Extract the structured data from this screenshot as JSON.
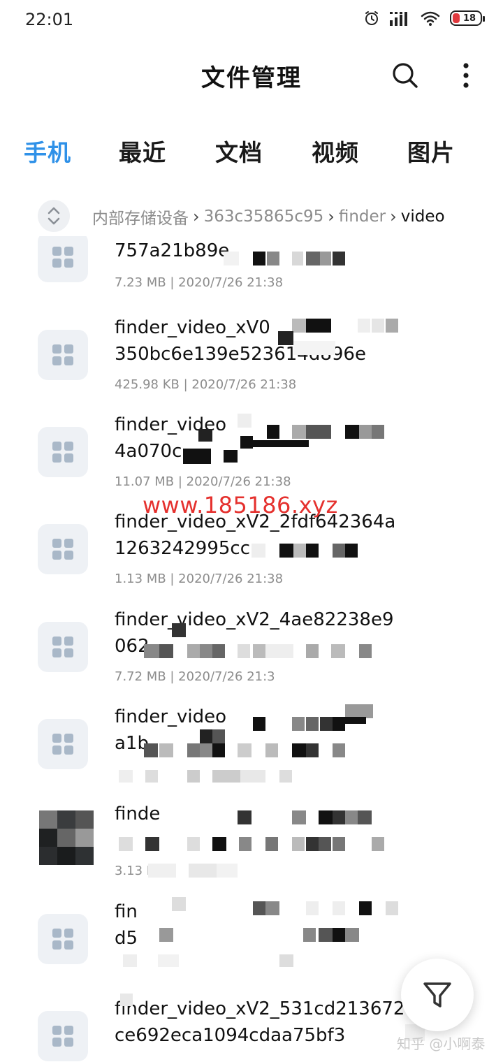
{
  "status_bar": {
    "time": "22:01",
    "battery": "18",
    "icons": [
      "alarm-icon",
      "signal-icon",
      "wifi-icon",
      "battery-icon"
    ]
  },
  "header": {
    "title": "文件管理",
    "icons": [
      "search-icon",
      "more-vertical-icon"
    ]
  },
  "tabs": [
    {
      "label": "手机",
      "active": true
    },
    {
      "label": "最近",
      "active": false
    },
    {
      "label": "文档",
      "active": false
    },
    {
      "label": "视频",
      "active": false
    },
    {
      "label": "图片",
      "active": false
    }
  ],
  "breadcrumb": {
    "toggle_icon": "expand-collapse-icon",
    "items": [
      "内部存储设备",
      "363c35865c95",
      "finder",
      "video"
    ]
  },
  "files": [
    {
      "line1": "757a21b89e",
      "line2": "",
      "meta": "7.23 MB  |  2020/7/26 21:38",
      "icon": "grid-icon"
    },
    {
      "line1": "finder_video_xV0",
      "line2": "350bc6e139e523614d896e",
      "meta": "425.98 KB  |  2020/7/26 21:38",
      "icon": "grid-icon"
    },
    {
      "line1": "finder_video",
      "line2": "4a070c",
      "meta": "11.07 MB  |  2020/7/26 21:38",
      "icon": "grid-icon"
    },
    {
      "line1": "finder_video_xV2_2fdf642364a",
      "line2": "1263242995cc",
      "meta": "1.13 MB  |  2020/7/26 21:38",
      "icon": "grid-icon"
    },
    {
      "line1": "finder_video_xV2_4ae82238e9",
      "line2": "062",
      "meta": "7.72 MB  |  2020/7/26 21:3",
      "icon": "grid-icon"
    },
    {
      "line1": "finder_video",
      "line2": "a1b",
      "meta": "",
      "icon": "grid-icon"
    },
    {
      "line1": "finde",
      "line2": "",
      "meta": "3.13 M",
      "icon": "video-thumbnail"
    },
    {
      "line1": "fin",
      "line2": "d5",
      "meta": "",
      "icon": "grid-icon"
    },
    {
      "line1": "finder_video_xV2_531cd213672",
      "line2": "ce692eca1094cdaa75bf3",
      "meta": "",
      "icon": "grid-icon"
    }
  ],
  "overlay": {
    "watermark": "www.185186.xyz",
    "zhihu": "知乎 @小啊泰"
  },
  "fab": {
    "icon": "filter-icon"
  },
  "colors": {
    "accent": "#2f91e8",
    "text": "#111111",
    "meta": "#8d8d8d",
    "watermark": "#e5312e",
    "thumb_bg": "#eef1f5",
    "grid_icon": "#a9b8c8"
  }
}
